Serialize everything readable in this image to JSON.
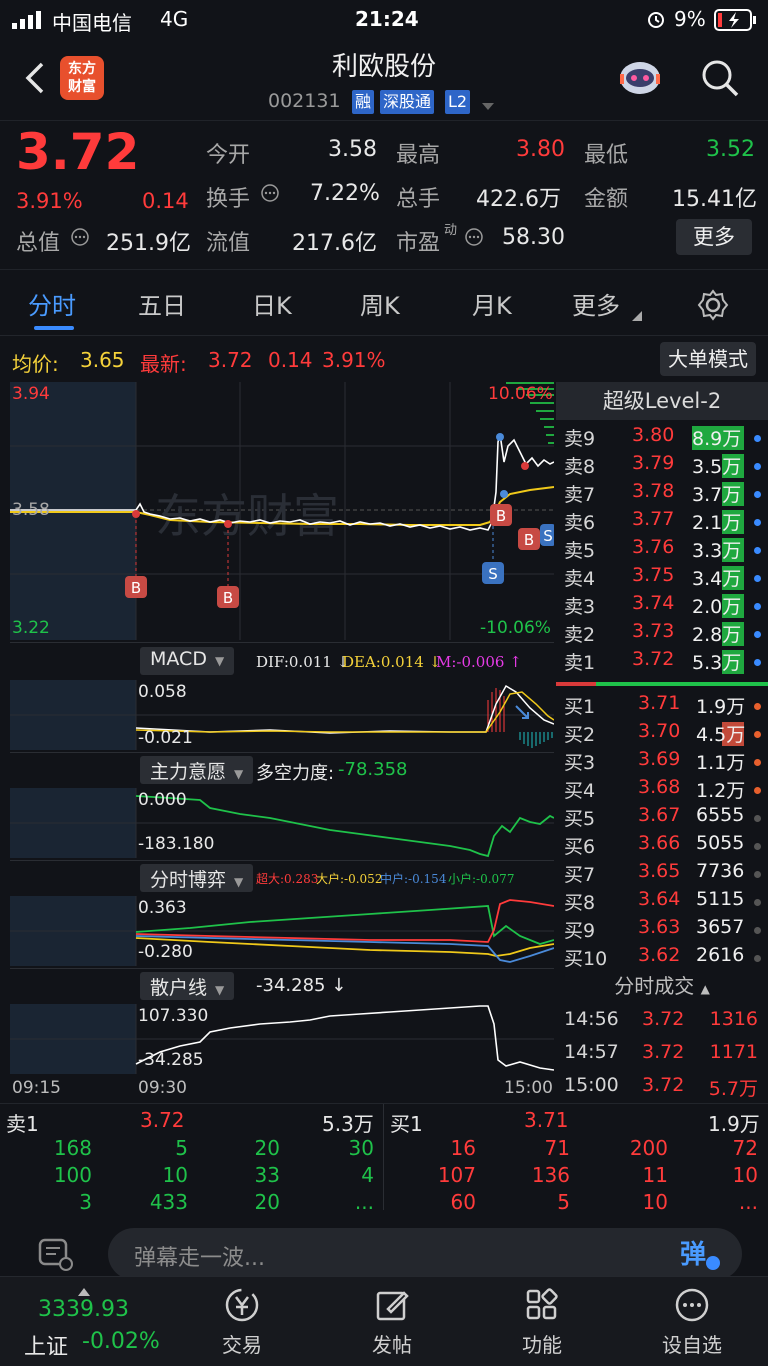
{
  "status_bar": {
    "carrier": "中国电信",
    "network": "4G",
    "time": "21:24",
    "battery": "9%"
  },
  "header": {
    "logo_text_1": "东方",
    "logo_text_2": "财富",
    "stock_name": "利欧股份",
    "stock_code": "002131",
    "tags": [
      "融",
      "深股通",
      "L2"
    ]
  },
  "quote": {
    "price": "3.72",
    "change_pct": "3.91%",
    "change": "0.14",
    "fields": [
      {
        "label": "今开",
        "value": "3.58",
        "color": "white"
      },
      {
        "label": "最高",
        "value": "3.80",
        "color": "red"
      },
      {
        "label": "最低",
        "value": "3.52",
        "color": "green"
      },
      {
        "label": "换手",
        "value": "7.22%",
        "color": "white"
      },
      {
        "label": "总手",
        "value": "422.6万",
        "color": "white"
      },
      {
        "label": "金额",
        "value": "15.41亿",
        "color": "white"
      },
      {
        "label": "总值",
        "value": "251.9亿",
        "color": "white"
      },
      {
        "label": "流值",
        "value": "217.6亿",
        "color": "white"
      },
      {
        "label": "市盈",
        "value": "58.30",
        "color": "white"
      }
    ],
    "pe_superscript": "动",
    "more_button": "更多"
  },
  "tabs": [
    "分时",
    "五日",
    "日K",
    "周K",
    "月K",
    "更多"
  ],
  "avg_line": {
    "avg_label": "均价:",
    "avg_value": "3.65",
    "latest_label": "最新:",
    "latest_value": "3.72",
    "latest_change": "0.14",
    "latest_pct": "3.91%",
    "big_order_button": "大单模式"
  },
  "price_chart": {
    "high": "3.94",
    "mid": "3.58",
    "low": "3.22",
    "high_pct": "10.06%",
    "low_pct": "-10.06%",
    "watermark": "东方财富",
    "markers": {
      "buy": "B",
      "sell": "S"
    }
  },
  "macd": {
    "label": "MACD",
    "dif": "DIF:0.011 ↓",
    "dea": "DEA:0.014 ↓",
    "m": "M:-0.006 ↑",
    "top": "0.058",
    "bottom": "-0.021"
  },
  "main_force": {
    "label": "主力意愿",
    "strength_label": "多空力度:",
    "strength_value": "-78.358",
    "top": "0.000",
    "bottom": "-183.180"
  },
  "game": {
    "label": "分时博弈",
    "super_large": "超大:0.283",
    "large": "大户:-0.052",
    "medium": "中户:-0.154",
    "small": "小户:-0.077",
    "top": "0.363",
    "bottom": "-0.280"
  },
  "retail": {
    "label": "散户线",
    "value": "-34.285 ↓",
    "top": "107.330",
    "bottom": "-34.285"
  },
  "time_axis": [
    "09:15",
    "09:30",
    "15:00"
  ],
  "orderbook": {
    "title": "超级Level-2",
    "asks": [
      {
        "label": "卖9",
        "price": "3.80",
        "vol": "8.9万"
      },
      {
        "label": "卖8",
        "price": "3.79",
        "vol": "3.5万"
      },
      {
        "label": "卖7",
        "price": "3.78",
        "vol": "3.7万"
      },
      {
        "label": "卖6",
        "price": "3.77",
        "vol": "2.1万"
      },
      {
        "label": "卖5",
        "price": "3.76",
        "vol": "3.3万"
      },
      {
        "label": "卖4",
        "price": "3.75",
        "vol": "3.4万"
      },
      {
        "label": "卖3",
        "price": "3.74",
        "vol": "2.0万"
      },
      {
        "label": "卖2",
        "price": "3.73",
        "vol": "2.8万"
      },
      {
        "label": "卖1",
        "price": "3.72",
        "vol": "5.3万"
      }
    ],
    "bids": [
      {
        "label": "买1",
        "price": "3.71",
        "vol": "1.9万"
      },
      {
        "label": "买2",
        "price": "3.70",
        "vol": "4.5万"
      },
      {
        "label": "买3",
        "price": "3.69",
        "vol": "1.1万"
      },
      {
        "label": "买4",
        "price": "3.68",
        "vol": "1.2万"
      },
      {
        "label": "买5",
        "price": "3.67",
        "vol": "6555"
      },
      {
        "label": "买6",
        "price": "3.66",
        "vol": "5055"
      },
      {
        "label": "买7",
        "price": "3.65",
        "vol": "7736"
      },
      {
        "label": "买8",
        "price": "3.64",
        "vol": "5115"
      },
      {
        "label": "买9",
        "price": "3.63",
        "vol": "3657"
      },
      {
        "label": "买10",
        "price": "3.62",
        "vol": "2616"
      }
    ],
    "trades_title": "分时成交",
    "trades": [
      {
        "time": "14:56",
        "price": "3.72",
        "vol": "1316"
      },
      {
        "time": "14:57",
        "price": "3.72",
        "vol": "1171"
      },
      {
        "time": "15:00",
        "price": "3.72",
        "vol": "5.7万"
      }
    ]
  },
  "queue": {
    "sell_label": "卖1",
    "sell_price": "3.72",
    "sell_vol": "5.3万",
    "buy_label": "买1",
    "buy_price": "3.71",
    "buy_vol": "1.9万",
    "sell_rows": [
      [
        "168",
        "5",
        "20",
        "30"
      ],
      [
        "100",
        "10",
        "33",
        "4"
      ],
      [
        "3",
        "433",
        "20",
        "..."
      ]
    ],
    "buy_rows": [
      [
        "16",
        "71",
        "200",
        "72"
      ],
      [
        "107",
        "136",
        "11",
        "10"
      ],
      [
        "60",
        "5",
        "10",
        "..."
      ]
    ]
  },
  "comment": {
    "placeholder": "弹幕走一波...",
    "danmu_button": "弹"
  },
  "bottom_nav": {
    "index_value": "3339.93",
    "index_name": "上证",
    "index_change": "-0.02%",
    "items": [
      "交易",
      "发帖",
      "功能",
      "设自选"
    ]
  }
}
